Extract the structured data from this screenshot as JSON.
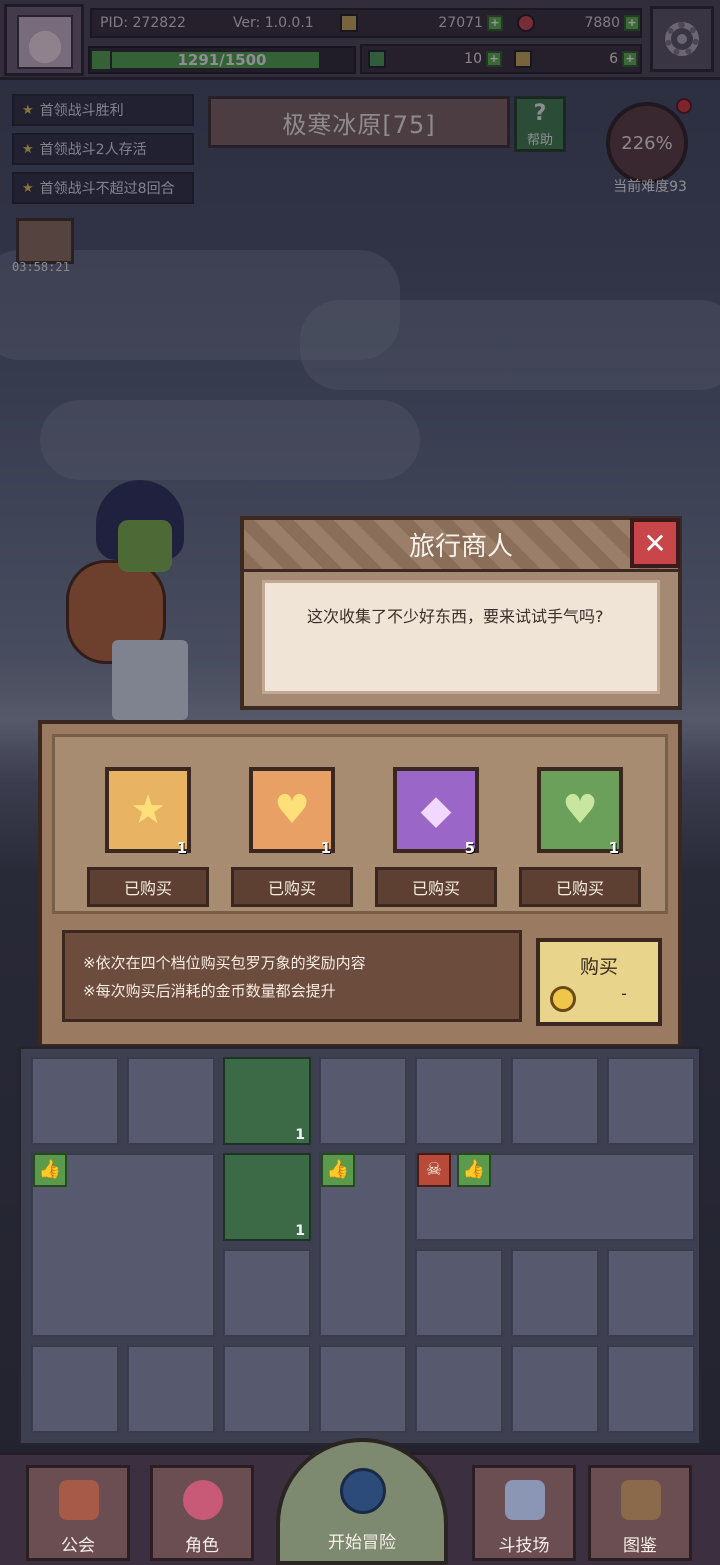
{
  "top_bar": {
    "pid": "PID: 272822",
    "version": "Ver: 1.0.0.1",
    "gold": "27071",
    "gems": "7880",
    "hp": "1291/1500",
    "hp_fraction": 0.861,
    "clover": "10",
    "key_count": "6"
  },
  "quests": [
    "首领战斗胜利",
    "首领战斗2人存活",
    "首领战斗不超过8回合"
  ],
  "stage": {
    "title": "极寒冰原[75]",
    "help_label": "帮助",
    "difficulty_percent": "226%",
    "difficulty_label": "当前难度93",
    "chest_timer": "03:58:21"
  },
  "merchant": {
    "title": "旅行商人",
    "message": "这次收集了不少好东西，要来试试手气吗?",
    "items": [
      {
        "icon": "star-icon",
        "glyph": "★",
        "color": "#e8b464",
        "count": "1",
        "status": "已购买"
      },
      {
        "icon": "heart-gold-icon",
        "glyph": "♥",
        "color": "#e8a064",
        "count": "1",
        "status": "已购买"
      },
      {
        "icon": "purple-gem-icon",
        "glyph": "◆",
        "color": "#9a66c8",
        "count": "5",
        "status": "已购买"
      },
      {
        "icon": "heart-green-icon",
        "glyph": "♥",
        "color": "#6aa05a",
        "count": "1",
        "status": "已购买"
      }
    ],
    "notes": [
      "※依次在四个档位购买包罗万象的奖励内容",
      "※每次购买后消耗的金币数量都会提升"
    ],
    "buy_label": "购买",
    "price": "-"
  },
  "inventory": {
    "counts": [
      "1",
      "1"
    ]
  },
  "nav": {
    "guild": "公会",
    "character": "角色",
    "adventure": "开始冒险",
    "arena": "斗技场",
    "codex": "图鉴"
  }
}
